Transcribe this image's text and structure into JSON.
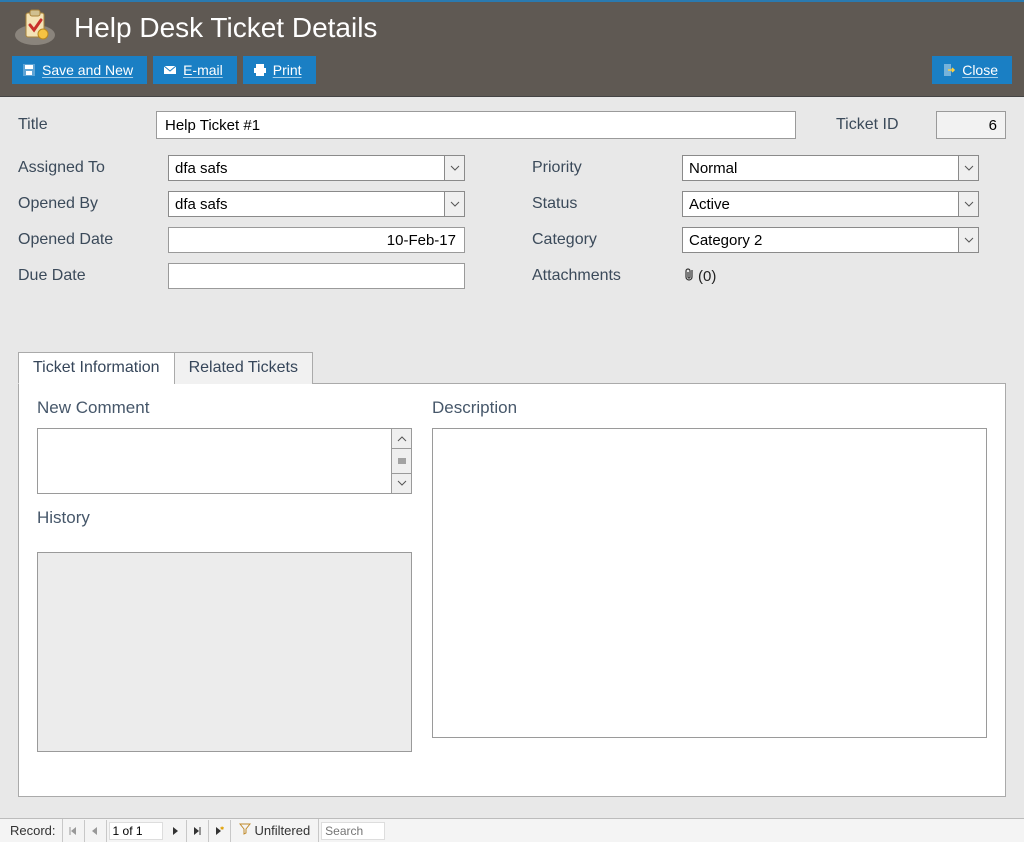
{
  "header": {
    "title": "Help Desk Ticket Details"
  },
  "toolbar": {
    "save_and_new": "Save and New",
    "email": "E-mail",
    "print": "Print",
    "close": "Close"
  },
  "labels": {
    "title": "Title",
    "ticket_id": "Ticket ID",
    "assigned_to": "Assigned To",
    "opened_by": "Opened By",
    "opened_date": "Opened Date",
    "due_date": "Due Date",
    "priority": "Priority",
    "status": "Status",
    "category": "Category",
    "attachments": "Attachments",
    "new_comment": "New Comment",
    "history": "History",
    "description": "Description"
  },
  "values": {
    "title": "Help Ticket #1",
    "ticket_id": "6",
    "assigned_to": "dfa safs",
    "opened_by": "dfa safs",
    "opened_date": "10-Feb-17",
    "due_date": "",
    "priority": "Normal",
    "status": "Active",
    "category": "Category 2",
    "attachments_count": "(0)",
    "new_comment": "",
    "history": "",
    "description": ""
  },
  "tabs": {
    "ticket_info": "Ticket Information",
    "related": "Related Tickets"
  },
  "statusbar": {
    "record_label": "Record:",
    "record_pos": "1 of 1",
    "filter_label": "Unfiltered",
    "search_placeholder": "Search"
  }
}
